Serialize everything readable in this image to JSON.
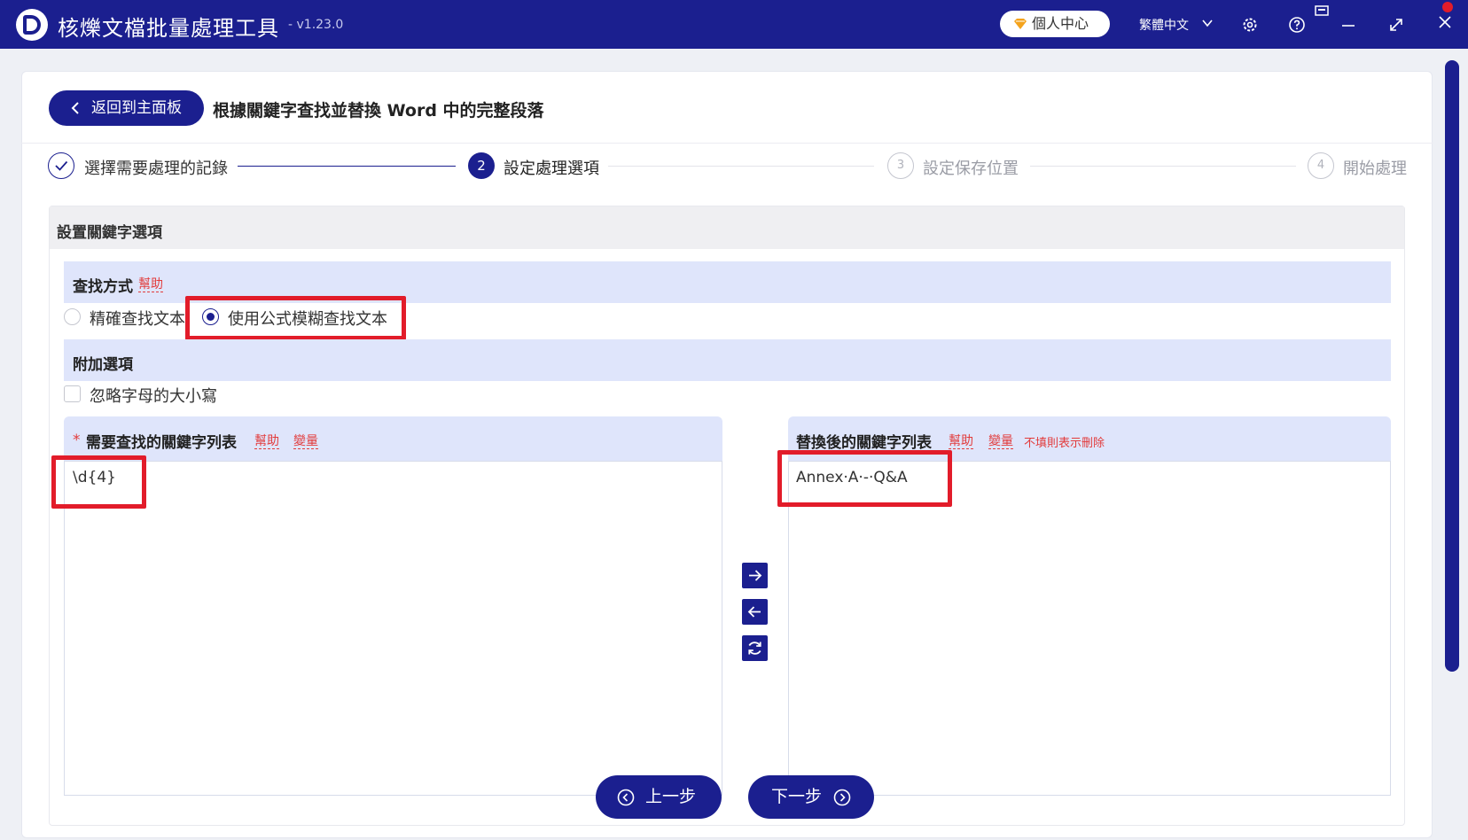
{
  "app": {
    "logo_letter": "D",
    "title": "核爍文檔批量處理工具",
    "version": "- v1.23.0",
    "user_center": "個人中心",
    "language": "繁體中文",
    "icons": [
      "settings-icon",
      "help-icon",
      "minimize-icon",
      "maximize-icon",
      "close-icon",
      "feedback-icon"
    ]
  },
  "header": {
    "back_label": "返回到主面板",
    "page_title": "根據關鍵字查找並替換 Word 中的完整段落"
  },
  "steps": [
    {
      "num": "",
      "label": "選擇需要處理的記錄",
      "state": "done"
    },
    {
      "num": "2",
      "label": "設定處理選項",
      "state": "active"
    },
    {
      "num": "3",
      "label": "設定保存位置",
      "state": "pending"
    },
    {
      "num": "4",
      "label": "開始處理",
      "state": "pending"
    }
  ],
  "options": {
    "panel_title": "設置關鍵字選項",
    "search_mode": {
      "title": "查找方式",
      "help": "幫助",
      "options": [
        "精確查找文本",
        "使用公式模糊查找文本"
      ],
      "selected": "使用公式模糊查找文本"
    },
    "extra": {
      "title": "附加選項",
      "ignore_case_label": "忽略字母的大小寫",
      "ignore_case_checked": false
    }
  },
  "find_list": {
    "required_mark": "*",
    "title": "需要查找的關鍵字列表",
    "help": "幫助",
    "variable": "變量",
    "value": "\\d{4}"
  },
  "replace_list": {
    "title": "替換後的關鍵字列表",
    "help": "幫助",
    "variable": "變量",
    "note": "不填則表示刪除",
    "value": "Annex·A·-·Q&A"
  },
  "footer": {
    "prev_label": "上一步",
    "next_label": "下一步"
  },
  "colors": {
    "primary": "#1b1f8f",
    "section_band": "#dfe5fb",
    "highlight": "#e21c2a",
    "help_link": "#e23b3b"
  }
}
